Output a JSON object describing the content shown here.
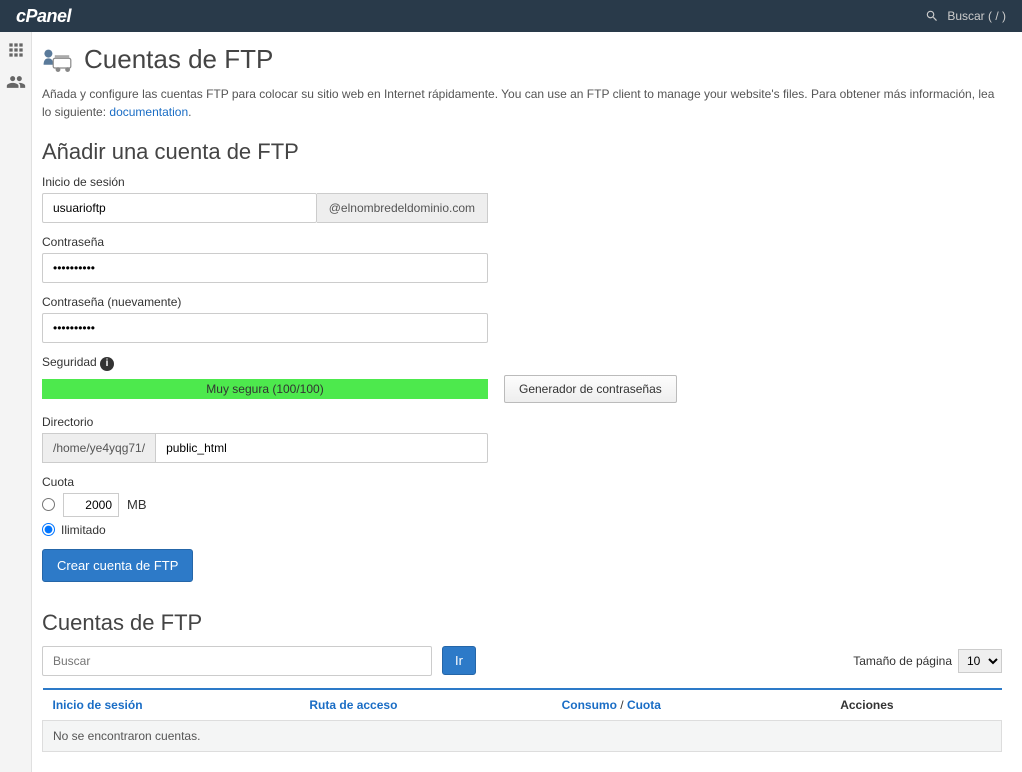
{
  "topbar": {
    "logo": "cPanel",
    "search_placeholder": "Buscar ( / )"
  },
  "page": {
    "title": "Cuentas de FTP",
    "intro_text": "Añada y configure las cuentas FTP para colocar su sitio web en Internet rápidamente. You can use an FTP client to manage your website's files. Para obtener más información, lea lo siguiente: ",
    "doc_link": "documentation",
    "doc_suffix": "."
  },
  "add": {
    "section_title": "Añadir una cuenta de FTP",
    "login_label": "Inicio de sesión",
    "login_value": "usuarioftp",
    "domain_suffix": "@elnombredeldominio.com",
    "password_label": "Contraseña",
    "password_value": "••••••••••",
    "password2_label": "Contraseña (nuevamente)",
    "password2_value": "••••••••••",
    "strength_label": "Seguridad",
    "strength_text": "Muy segura (100/100)",
    "pw_generator": "Generador de contraseñas",
    "directory_label": "Directorio",
    "home_prefix": "/home/ye4yqg71/",
    "directory_value": "public_html",
    "quota_label": "Cuota",
    "quota_value": "2000",
    "quota_unit": "MB",
    "quota_unlimited": "Ilimitado",
    "create_button": "Crear cuenta de FTP"
  },
  "list": {
    "section_title": "Cuentas de FTP",
    "search_placeholder": "Buscar",
    "go_button": "Ir",
    "page_size_label": "Tamaño de página",
    "page_size_value": "10",
    "col_login": "Inicio de sesión",
    "col_path": "Ruta de acceso",
    "col_usage": "Consumo",
    "col_sep": " / ",
    "col_quota": "Cuota",
    "col_actions": "Acciones",
    "empty_text": "No se encontraron cuentas."
  }
}
